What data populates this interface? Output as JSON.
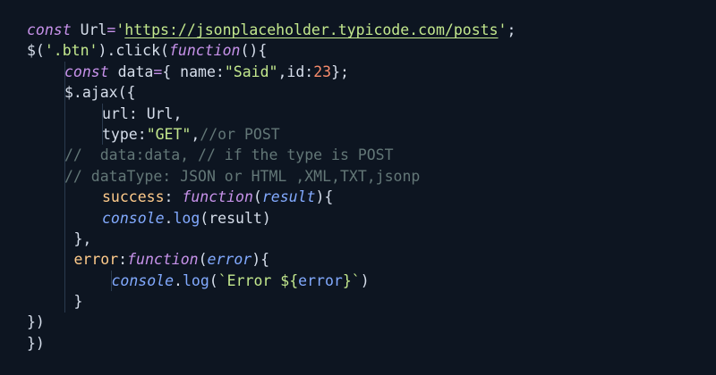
{
  "editor": {
    "background": "#0d1521",
    "lines": [
      {
        "indent": 0,
        "tokens": [
          {
            "t": "const",
            "c": "kw"
          },
          {
            "t": " ",
            "c": "pn"
          },
          {
            "t": "Url",
            "c": "id"
          },
          {
            "t": "=",
            "c": "op"
          },
          {
            "t": "'",
            "c": "str"
          },
          {
            "t": "https://jsonplaceholder.typicode.com/posts",
            "c": "url"
          },
          {
            "t": "'",
            "c": "str"
          },
          {
            "t": ";",
            "c": "pn"
          }
        ]
      },
      {
        "indent": 0,
        "tokens": [
          {
            "t": "$(",
            "c": "pn"
          },
          {
            "t": "'.btn'",
            "c": "str"
          },
          {
            "t": ").",
            "c": "pn"
          },
          {
            "t": "click",
            "c": "id"
          },
          {
            "t": "(",
            "c": "pn"
          },
          {
            "t": "function",
            "c": "kw"
          },
          {
            "t": "(){",
            "c": "pn"
          }
        ]
      },
      {
        "indent": 1,
        "tokens": [
          {
            "t": "const",
            "c": "kw"
          },
          {
            "t": " ",
            "c": "pn"
          },
          {
            "t": "data",
            "c": "id"
          },
          {
            "t": "=",
            "c": "op"
          },
          {
            "t": "{ ",
            "c": "pn"
          },
          {
            "t": "name",
            "c": "prop"
          },
          {
            "t": ":",
            "c": "pn"
          },
          {
            "t": "\"Said\"",
            "c": "str"
          },
          {
            "t": ",",
            "c": "pn"
          },
          {
            "t": "id",
            "c": "prop"
          },
          {
            "t": ":",
            "c": "pn"
          },
          {
            "t": "23",
            "c": "num"
          },
          {
            "t": "};",
            "c": "pn"
          }
        ]
      },
      {
        "indent": 1,
        "tokens": [
          {
            "t": "$.",
            "c": "pn"
          },
          {
            "t": "ajax",
            "c": "id"
          },
          {
            "t": "({",
            "c": "pn"
          }
        ]
      },
      {
        "indent": 2,
        "tokens": [
          {
            "t": "url",
            "c": "prop"
          },
          {
            "t": ": ",
            "c": "pn"
          },
          {
            "t": "Url",
            "c": "id"
          },
          {
            "t": ",",
            "c": "pn"
          }
        ]
      },
      {
        "indent": 2,
        "tokens": [
          {
            "t": "type",
            "c": "prop"
          },
          {
            "t": ":",
            "c": "pn"
          },
          {
            "t": "\"GET\"",
            "c": "str"
          },
          {
            "t": ",",
            "c": "pn"
          },
          {
            "t": "//or POST",
            "c": "cm"
          }
        ]
      },
      {
        "indent": 1,
        "tokens": [
          {
            "t": "//  data:data, // if the type is POST",
            "c": "cm"
          }
        ]
      },
      {
        "indent": 1,
        "tokens": [
          {
            "t": "// dataType: JSON or HTML ,XML,TXT,jsonp",
            "c": "cm"
          }
        ]
      },
      {
        "indent": 2,
        "tokens": [
          {
            "t": "success",
            "c": "key"
          },
          {
            "t": ": ",
            "c": "pn"
          },
          {
            "t": "function",
            "c": "kw"
          },
          {
            "t": "(",
            "c": "pn"
          },
          {
            "t": "result",
            "c": "arg"
          },
          {
            "t": "){",
            "c": "pn"
          }
        ]
      },
      {
        "indent": 2,
        "tokens": [
          {
            "t": "console",
            "c": "obj"
          },
          {
            "t": ".",
            "c": "pn"
          },
          {
            "t": "log",
            "c": "fn"
          },
          {
            "t": "(",
            "c": "pn"
          },
          {
            "t": "result",
            "c": "id"
          },
          {
            "t": ")",
            "c": "pn"
          }
        ]
      },
      {
        "indent": 1.25,
        "tokens": [
          {
            "t": "},",
            "c": "pn"
          }
        ]
      },
      {
        "indent": 1.25,
        "tokens": [
          {
            "t": "error",
            "c": "key"
          },
          {
            "t": ":",
            "c": "pn"
          },
          {
            "t": "function",
            "c": "kw"
          },
          {
            "t": "(",
            "c": "pn"
          },
          {
            "t": "error",
            "c": "arg"
          },
          {
            "t": "){",
            "c": "pn"
          }
        ]
      },
      {
        "indent": 2.25,
        "tokens": [
          {
            "t": "console",
            "c": "obj"
          },
          {
            "t": ".",
            "c": "pn"
          },
          {
            "t": "log",
            "c": "fn"
          },
          {
            "t": "(",
            "c": "pn"
          },
          {
            "t": "`Error ",
            "c": "str"
          },
          {
            "t": "${",
            "c": "str"
          },
          {
            "t": "error",
            "c": "fn"
          },
          {
            "t": "}",
            "c": "str"
          },
          {
            "t": "`",
            "c": "str"
          },
          {
            "t": ")",
            "c": "pn"
          }
        ]
      },
      {
        "indent": 1.25,
        "tokens": [
          {
            "t": "}",
            "c": "pn"
          }
        ]
      },
      {
        "indent": 0,
        "tokens": [
          {
            "t": "})",
            "c": "pn"
          }
        ]
      },
      {
        "indent": 0,
        "tokens": [
          {
            "t": "})",
            "c": "pn"
          }
        ]
      }
    ]
  }
}
